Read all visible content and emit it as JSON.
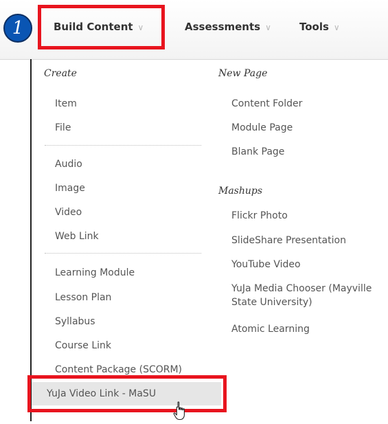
{
  "step_badge": "1",
  "toolbar": {
    "build_content": "Build Content",
    "assessments": "Assessments",
    "tools": "Tools",
    "chevron": "∨"
  },
  "menu": {
    "col1": {
      "heading": "Create",
      "group1": [
        "Item",
        "File"
      ],
      "group2": [
        "Audio",
        "Image",
        "Video",
        "Web Link"
      ],
      "group3": [
        "Learning Module",
        "Lesson Plan",
        "Syllabus",
        "Course Link",
        "Content Package (SCORM)",
        "YuJa Video Link - MaSU"
      ]
    },
    "col2": {
      "heading": "New Page",
      "items": [
        "Content Folder",
        "Module Page",
        "Blank Page"
      ],
      "heading2": "Mashups",
      "mashups": [
        "Flickr Photo",
        "SlideShare Presentation",
        "YouTube Video",
        "YuJa Media Chooser (Mayville State University)",
        "Atomic Learning"
      ]
    }
  },
  "colors": {
    "highlight": "#e8141e",
    "badge": "#0a55b3",
    "selected_bg": "#e6e6e6"
  },
  "icons": {
    "cursor": "hand-pointer-icon",
    "dropdown": "chevron-down-icon"
  }
}
